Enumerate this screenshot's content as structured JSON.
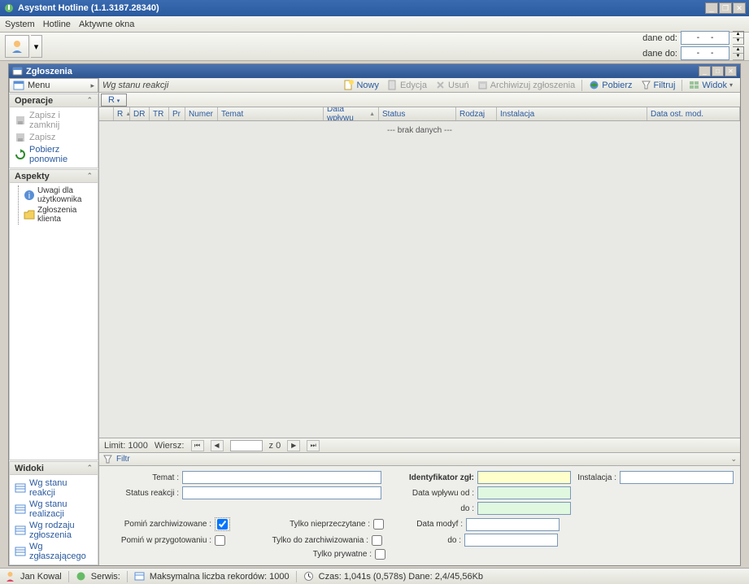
{
  "title": "Asystent Hotline  (1.1.3187.28340)",
  "menubar": {
    "system": "System",
    "hotline": "Hotline",
    "windows": "Aktywne okna"
  },
  "dates": {
    "from_label": "dane od:",
    "to_label": "dane do:",
    "from": "-     -",
    "to": "-     -"
  },
  "subwindow": {
    "title": "Zgłoszenia"
  },
  "side_menu": {
    "label": "Menu"
  },
  "sections": {
    "operacje": "Operacje",
    "aspekty": "Aspekty",
    "widoki": "Widoki"
  },
  "ops": {
    "save_close": "Zapisz i zamknij",
    "save": "Zapisz",
    "reload": "Pobierz ponownie"
  },
  "aspects": {
    "user_notes": "Uwagi dla użytkownika",
    "client_tickets": "Zgłoszenia klienta"
  },
  "views": {
    "reaction": "Wg stanu reakcji",
    "realization": "Wg stanu realizacji",
    "type": "Wg rodzaju zgłoszenia",
    "reporter": "Wg zgłaszającego"
  },
  "view_title": "Wg stanu reakcji",
  "toolbar": {
    "new": "Nowy",
    "edit": "Edycja",
    "delete": "Usuń",
    "archive": "Archiwizuj zgłoszenia",
    "fetch": "Pobierz",
    "filter": "Filtruj",
    "view": "Widok"
  },
  "rtoggle": "R",
  "columns": {
    "empty": "",
    "r": "R",
    "dr": "DR",
    "tr": "TR",
    "pr": "Pr",
    "numer": "Numer",
    "temat": "Temat",
    "data_wplywu": "Data wpływu",
    "status": "Status",
    "rodzaj": "Rodzaj",
    "instalacja": "Instalacja",
    "data_mod": "Data ost. mod."
  },
  "grid": {
    "nodata": "--- brak danych ---"
  },
  "pager": {
    "limit_label": "Limit:",
    "limit": "1000",
    "row_label": "Wiersz:",
    "row": "",
    "of": "z",
    "total": "0"
  },
  "filter": {
    "title": "Filtr",
    "temat": "Temat :",
    "status_reakcji": "Status reakcji :",
    "pomin_arch": "Pomiń zarchiwizowane :",
    "pomin_przyg": "Pomiń w przygotowaniu :",
    "tylko_nieprz": "Tylko nieprzeczytane :",
    "tylko_doarch": "Tylko do zarchiwizowania :",
    "tylko_pryw": "Tylko prywatne :",
    "ident": "Identyfikator zgł:",
    "data_wplywu_od": "Data wpływu od :",
    "do1": "do :",
    "data_modyf": "Data modyf :",
    "do2": "do :",
    "instalacja": "Instalacja :"
  },
  "status": {
    "user": "Jan Kowal",
    "service": "Serwis:",
    "maxrec": "Maksymalna liczba rekordów: 1000",
    "time": "Czas: 1,041s (0,578s) Dane: 2,4/45,56Kb"
  }
}
